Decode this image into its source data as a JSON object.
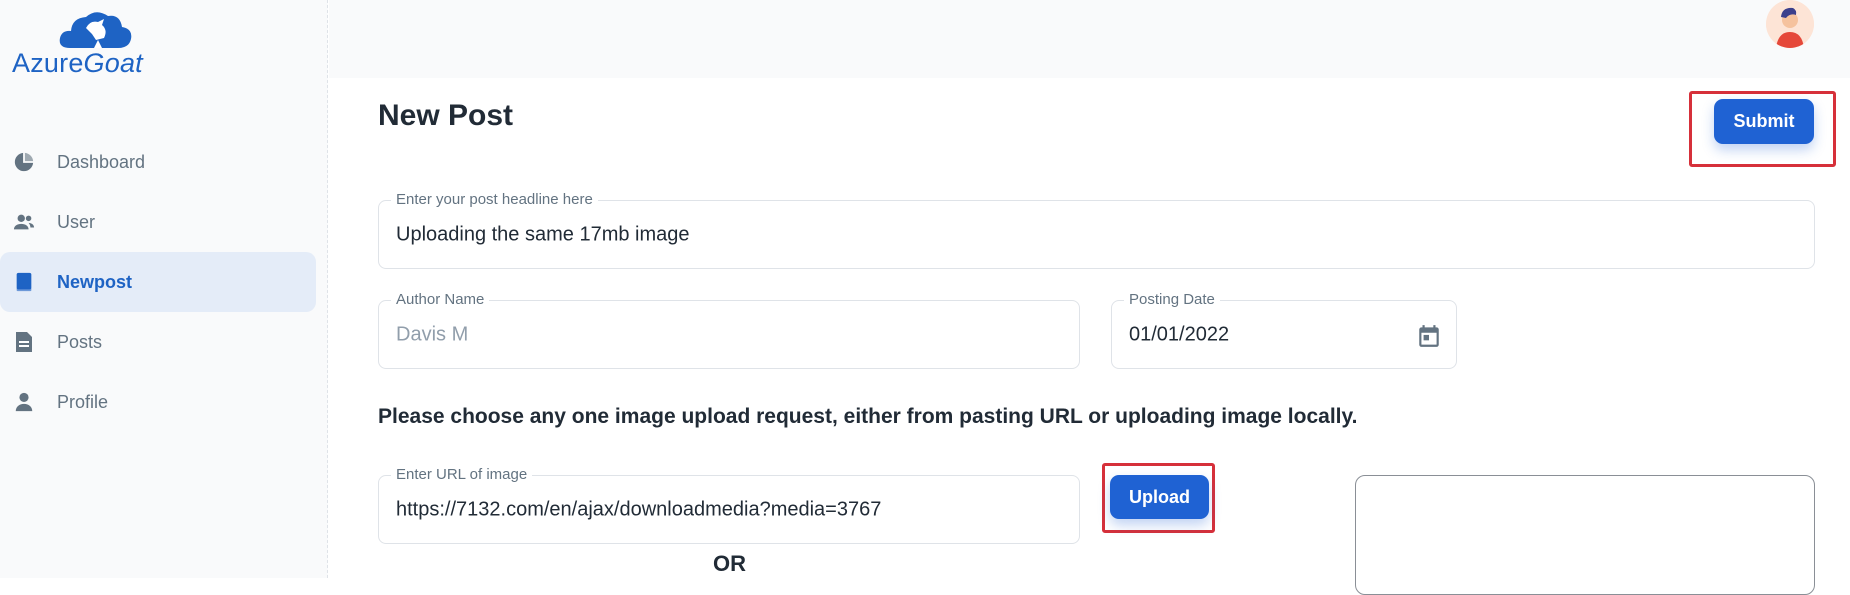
{
  "brand": {
    "name_part1": "Azure",
    "name_part2": "Goat",
    "color": "#1e63c4"
  },
  "sidebar": {
    "items": [
      {
        "label": "Dashboard",
        "icon": "pie-chart-icon",
        "active": false
      },
      {
        "label": "User",
        "icon": "users-icon",
        "active": false
      },
      {
        "label": "Newpost",
        "icon": "book-icon",
        "active": true
      },
      {
        "label": "Posts",
        "icon": "document-icon",
        "active": false
      },
      {
        "label": "Profile",
        "icon": "person-icon",
        "active": false
      }
    ]
  },
  "header": {
    "avatar_icon": "user-avatar-icon"
  },
  "main": {
    "title": "New Post",
    "submit_label": "Submit",
    "headline": {
      "label": "Enter your post headline here",
      "value": "Uploading the same 17mb image"
    },
    "author": {
      "label": "Author Name",
      "value": "Davis M"
    },
    "date": {
      "label": "Posting Date",
      "value": "01/01/2022",
      "icon": "calendar-icon"
    },
    "instruction": "Please choose any one image upload request, either from pasting URL or uploading image locally.",
    "url": {
      "label": "Enter URL of image",
      "value": "https://7132.com/en/ajax/downloadmedia?media=3767"
    },
    "upload_label": "Upload",
    "or_label": "OR"
  },
  "colors": {
    "accent": "#1f62d3",
    "highlight": "#d6303a",
    "active_bg": "#e4ecf8"
  }
}
